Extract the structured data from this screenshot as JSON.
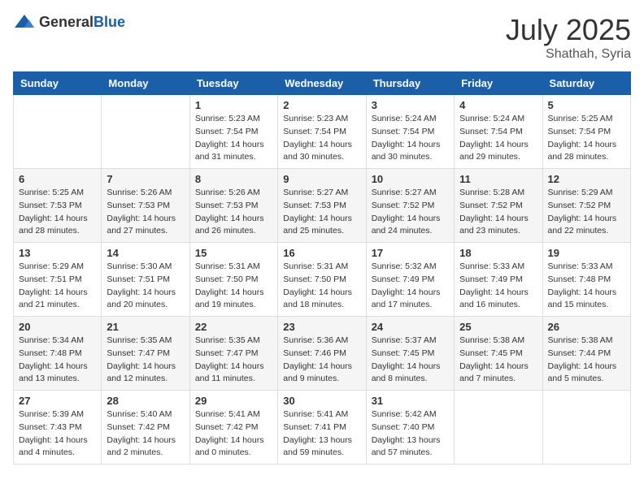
{
  "logo": {
    "text_general": "General",
    "text_blue": "Blue"
  },
  "title": {
    "month_year": "July 2025",
    "location": "Shathah, Syria"
  },
  "weekdays": [
    "Sunday",
    "Monday",
    "Tuesday",
    "Wednesday",
    "Thursday",
    "Friday",
    "Saturday"
  ],
  "weeks": [
    [
      {
        "day": "",
        "sunrise": "",
        "sunset": "",
        "daylight": ""
      },
      {
        "day": "",
        "sunrise": "",
        "sunset": "",
        "daylight": ""
      },
      {
        "day": "1",
        "sunrise": "Sunrise: 5:23 AM",
        "sunset": "Sunset: 7:54 PM",
        "daylight": "Daylight: 14 hours and 31 minutes."
      },
      {
        "day": "2",
        "sunrise": "Sunrise: 5:23 AM",
        "sunset": "Sunset: 7:54 PM",
        "daylight": "Daylight: 14 hours and 30 minutes."
      },
      {
        "day": "3",
        "sunrise": "Sunrise: 5:24 AM",
        "sunset": "Sunset: 7:54 PM",
        "daylight": "Daylight: 14 hours and 30 minutes."
      },
      {
        "day": "4",
        "sunrise": "Sunrise: 5:24 AM",
        "sunset": "Sunset: 7:54 PM",
        "daylight": "Daylight: 14 hours and 29 minutes."
      },
      {
        "day": "5",
        "sunrise": "Sunrise: 5:25 AM",
        "sunset": "Sunset: 7:54 PM",
        "daylight": "Daylight: 14 hours and 28 minutes."
      }
    ],
    [
      {
        "day": "6",
        "sunrise": "Sunrise: 5:25 AM",
        "sunset": "Sunset: 7:53 PM",
        "daylight": "Daylight: 14 hours and 28 minutes."
      },
      {
        "day": "7",
        "sunrise": "Sunrise: 5:26 AM",
        "sunset": "Sunset: 7:53 PM",
        "daylight": "Daylight: 14 hours and 27 minutes."
      },
      {
        "day": "8",
        "sunrise": "Sunrise: 5:26 AM",
        "sunset": "Sunset: 7:53 PM",
        "daylight": "Daylight: 14 hours and 26 minutes."
      },
      {
        "day": "9",
        "sunrise": "Sunrise: 5:27 AM",
        "sunset": "Sunset: 7:53 PM",
        "daylight": "Daylight: 14 hours and 25 minutes."
      },
      {
        "day": "10",
        "sunrise": "Sunrise: 5:27 AM",
        "sunset": "Sunset: 7:52 PM",
        "daylight": "Daylight: 14 hours and 24 minutes."
      },
      {
        "day": "11",
        "sunrise": "Sunrise: 5:28 AM",
        "sunset": "Sunset: 7:52 PM",
        "daylight": "Daylight: 14 hours and 23 minutes."
      },
      {
        "day": "12",
        "sunrise": "Sunrise: 5:29 AM",
        "sunset": "Sunset: 7:52 PM",
        "daylight": "Daylight: 14 hours and 22 minutes."
      }
    ],
    [
      {
        "day": "13",
        "sunrise": "Sunrise: 5:29 AM",
        "sunset": "Sunset: 7:51 PM",
        "daylight": "Daylight: 14 hours and 21 minutes."
      },
      {
        "day": "14",
        "sunrise": "Sunrise: 5:30 AM",
        "sunset": "Sunset: 7:51 PM",
        "daylight": "Daylight: 14 hours and 20 minutes."
      },
      {
        "day": "15",
        "sunrise": "Sunrise: 5:31 AM",
        "sunset": "Sunset: 7:50 PM",
        "daylight": "Daylight: 14 hours and 19 minutes."
      },
      {
        "day": "16",
        "sunrise": "Sunrise: 5:31 AM",
        "sunset": "Sunset: 7:50 PM",
        "daylight": "Daylight: 14 hours and 18 minutes."
      },
      {
        "day": "17",
        "sunrise": "Sunrise: 5:32 AM",
        "sunset": "Sunset: 7:49 PM",
        "daylight": "Daylight: 14 hours and 17 minutes."
      },
      {
        "day": "18",
        "sunrise": "Sunrise: 5:33 AM",
        "sunset": "Sunset: 7:49 PM",
        "daylight": "Daylight: 14 hours and 16 minutes."
      },
      {
        "day": "19",
        "sunrise": "Sunrise: 5:33 AM",
        "sunset": "Sunset: 7:48 PM",
        "daylight": "Daylight: 14 hours and 15 minutes."
      }
    ],
    [
      {
        "day": "20",
        "sunrise": "Sunrise: 5:34 AM",
        "sunset": "Sunset: 7:48 PM",
        "daylight": "Daylight: 14 hours and 13 minutes."
      },
      {
        "day": "21",
        "sunrise": "Sunrise: 5:35 AM",
        "sunset": "Sunset: 7:47 PM",
        "daylight": "Daylight: 14 hours and 12 minutes."
      },
      {
        "day": "22",
        "sunrise": "Sunrise: 5:35 AM",
        "sunset": "Sunset: 7:47 PM",
        "daylight": "Daylight: 14 hours and 11 minutes."
      },
      {
        "day": "23",
        "sunrise": "Sunrise: 5:36 AM",
        "sunset": "Sunset: 7:46 PM",
        "daylight": "Daylight: 14 hours and 9 minutes."
      },
      {
        "day": "24",
        "sunrise": "Sunrise: 5:37 AM",
        "sunset": "Sunset: 7:45 PM",
        "daylight": "Daylight: 14 hours and 8 minutes."
      },
      {
        "day": "25",
        "sunrise": "Sunrise: 5:38 AM",
        "sunset": "Sunset: 7:45 PM",
        "daylight": "Daylight: 14 hours and 7 minutes."
      },
      {
        "day": "26",
        "sunrise": "Sunrise: 5:38 AM",
        "sunset": "Sunset: 7:44 PM",
        "daylight": "Daylight: 14 hours and 5 minutes."
      }
    ],
    [
      {
        "day": "27",
        "sunrise": "Sunrise: 5:39 AM",
        "sunset": "Sunset: 7:43 PM",
        "daylight": "Daylight: 14 hours and 4 minutes."
      },
      {
        "day": "28",
        "sunrise": "Sunrise: 5:40 AM",
        "sunset": "Sunset: 7:42 PM",
        "daylight": "Daylight: 14 hours and 2 minutes."
      },
      {
        "day": "29",
        "sunrise": "Sunrise: 5:41 AM",
        "sunset": "Sunset: 7:42 PM",
        "daylight": "Daylight: 14 hours and 0 minutes."
      },
      {
        "day": "30",
        "sunrise": "Sunrise: 5:41 AM",
        "sunset": "Sunset: 7:41 PM",
        "daylight": "Daylight: 13 hours and 59 minutes."
      },
      {
        "day": "31",
        "sunrise": "Sunrise: 5:42 AM",
        "sunset": "Sunset: 7:40 PM",
        "daylight": "Daylight: 13 hours and 57 minutes."
      },
      {
        "day": "",
        "sunrise": "",
        "sunset": "",
        "daylight": ""
      },
      {
        "day": "",
        "sunrise": "",
        "sunset": "",
        "daylight": ""
      }
    ]
  ]
}
